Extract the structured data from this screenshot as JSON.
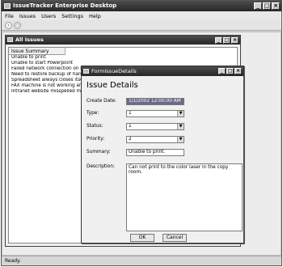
{
  "app": {
    "title": "IssueTracker Enterprise Desktop",
    "menu": [
      "File",
      "Issues",
      "Users",
      "Settings",
      "Help"
    ],
    "toolbar_icons": [
      "back-icon",
      "refresh-icon"
    ],
    "status": "Ready."
  },
  "list_window": {
    "title": "All Issues",
    "column_header": "Issue Summary",
    "rows": [
      "Unable to print",
      "Unable to start Powerpoint",
      "Failed network connection on my lap",
      "Need to restore backup of hard drive",
      "Spreadsheet always closes itself.",
      "FAX machine is not working anymore",
      "Intranet website misspelled my name"
    ]
  },
  "dialog": {
    "title": "FormIssueDetails",
    "heading": "Issue Details",
    "create_date_label": "Create Date:",
    "create_date_value": "1/1/2002 12:00:00 AM",
    "type_label": "Type:",
    "type_value": "1",
    "status_label": "Status:",
    "status_value": "1",
    "priority_label": "Priority:",
    "priority_value": "2",
    "summary_label": "Summary:",
    "summary_value": "Unable to print.",
    "description_label": "Description:",
    "description_value": "Can not print to the color laser in the copy room.",
    "ok_label": "OK",
    "cancel_label": "Cancel"
  },
  "window_buttons": {
    "minimize": "_",
    "maximize": "□",
    "close": "×"
  },
  "combo_arrow": "▼",
  "colors": {
    "titlebar": "#2e2e2e",
    "background": "#d6d6d6",
    "selection": "#6a6a8a"
  }
}
